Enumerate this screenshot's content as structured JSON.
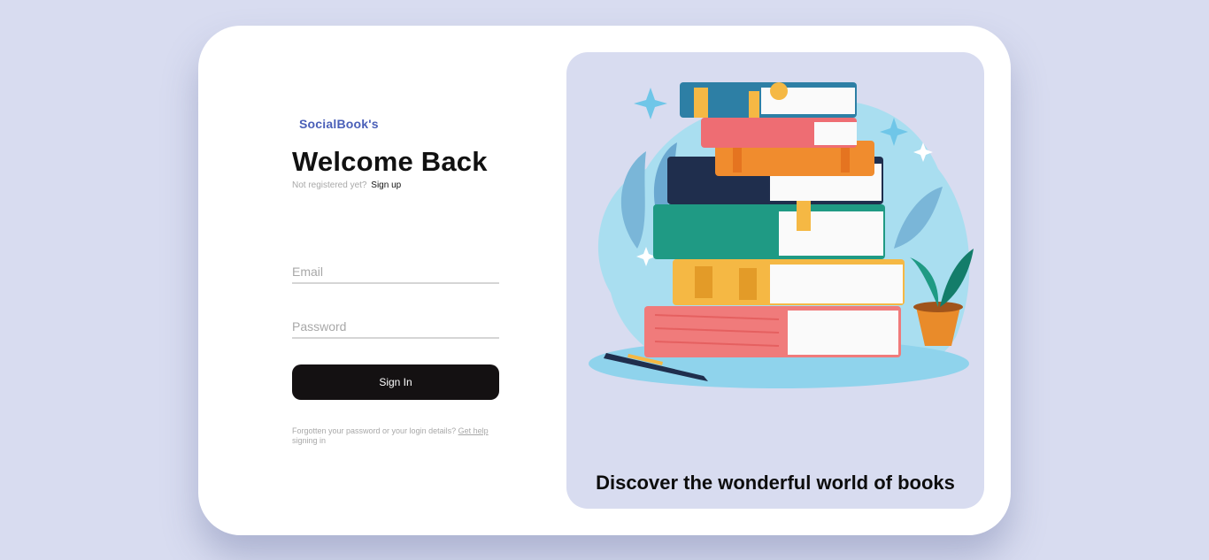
{
  "brand": "SocialBook's",
  "login": {
    "title": "Welcome Back",
    "not_registered": "Not registered yet?",
    "signup_link": "Sign up",
    "email_placeholder": "Email",
    "password_placeholder": "Password",
    "signin_label": "Sign In",
    "help_text": "Forgotten your password or your login details?",
    "help_link": "Get help",
    "help_suffix": "signing in"
  },
  "hero": {
    "tagline": "Discover the wonderful world of books",
    "image_icon": "books-stack-illustration"
  },
  "colors": {
    "background": "#d8dcf0",
    "brand": "#4a5fb8",
    "button": "#141112"
  }
}
